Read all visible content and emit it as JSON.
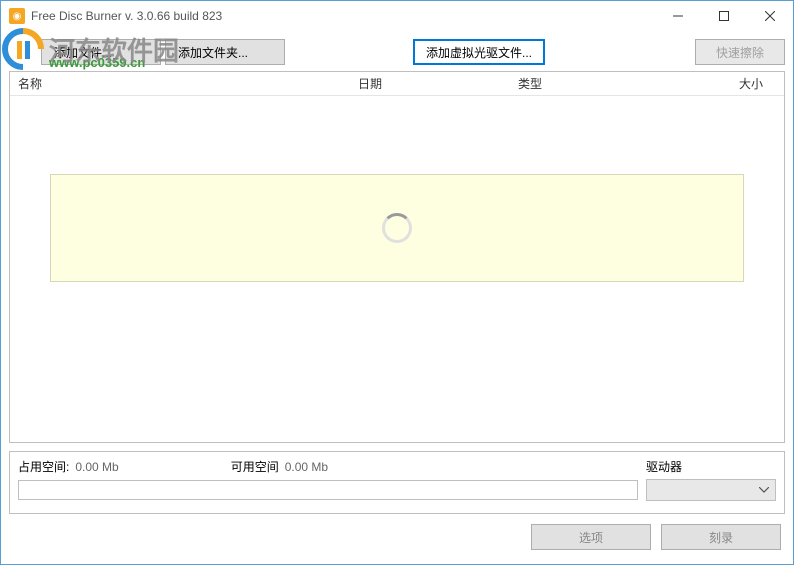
{
  "window": {
    "title": "Free Disc Burner   v. 3.0.66 build 823"
  },
  "watermark": {
    "text": "河东软件园",
    "url": "www.pc0359.cn"
  },
  "toolbar": {
    "add_files": "添加文件...",
    "add_folder": "添加文件夹...",
    "add_virtual": "添加虚拟光驱文件...",
    "quick_erase": "快速擦除"
  },
  "columns": {
    "name": "名称",
    "date": "日期",
    "type": "类型",
    "size": "大小"
  },
  "status": {
    "used_label": "占用空间:",
    "used_value": "0.00 Mb",
    "free_label": "可用空间",
    "free_value": "0.00 Mb",
    "drive_label": "驱动器"
  },
  "buttons": {
    "options": "选项",
    "burn": "刻录"
  }
}
